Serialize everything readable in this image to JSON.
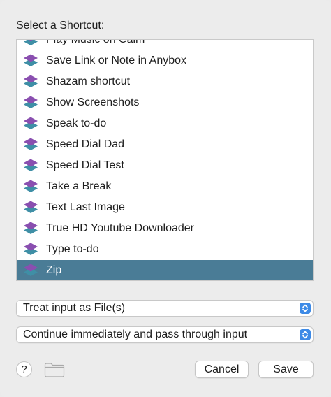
{
  "dialog": {
    "prompt": "Select a Shortcut:",
    "shortcuts": [
      {
        "label": "Play Music on Calm",
        "icon": "shortcut-stack-icon",
        "selected": false
      },
      {
        "label": "Save Link or Note in Anybox",
        "icon": "shortcut-stack-icon",
        "selected": false
      },
      {
        "label": "Shazam shortcut",
        "icon": "shortcut-stack-icon",
        "selected": false
      },
      {
        "label": "Show Screenshots",
        "icon": "shortcut-stack-icon",
        "selected": false
      },
      {
        "label": "Speak to-do",
        "icon": "shortcut-stack-icon",
        "selected": false
      },
      {
        "label": "Speed Dial Dad",
        "icon": "shortcut-stack-icon",
        "selected": false
      },
      {
        "label": "Speed Dial Test",
        "icon": "shortcut-stack-icon",
        "selected": false
      },
      {
        "label": "Take a Break",
        "icon": "shortcut-stack-icon",
        "selected": false
      },
      {
        "label": "Text Last Image",
        "icon": "shortcut-stack-icon",
        "selected": false
      },
      {
        "label": "True HD Youtube Downloader",
        "icon": "shortcut-stack-icon",
        "selected": false
      },
      {
        "label": "Type to-do",
        "icon": "shortcut-stack-icon",
        "selected": false
      },
      {
        "label": "Zip",
        "icon": "shortcut-stack-icon",
        "selected": true
      }
    ],
    "input_mode": {
      "value": "Treat input as File(s)",
      "icon": "up-down-arrows-icon"
    },
    "output_mode": {
      "value": "Continue immediately and pass through input",
      "icon": "up-down-arrows-icon"
    },
    "help_label": "?",
    "folder_icon": "folder-icon",
    "cancel_label": "Cancel",
    "save_label": "Save"
  },
  "colors": {
    "selection": "#4a7c96",
    "accent": "#3d8ae6",
    "icon_purple": "#8a4fb0",
    "icon_teal": "#3f8fa6"
  }
}
